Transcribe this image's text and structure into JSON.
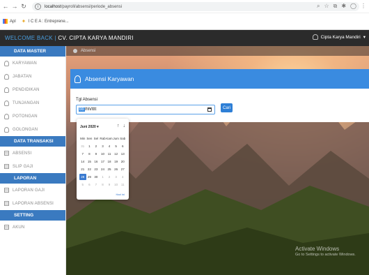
{
  "browser": {
    "url_host": "localhost",
    "url_path": "/payroll/absensi/periode_absensi",
    "bookmarks": [
      {
        "label": "Apl"
      },
      {
        "label": "I C E A : Entreprene..."
      }
    ]
  },
  "topbar": {
    "welcome": "WELCOME BACK |",
    "company": "CV. CIPTA KARYA MANDIRI",
    "user": "Cipta Karya Mandiri",
    "user_caret": "▾"
  },
  "sidebar": {
    "sections": [
      {
        "title": "DATA MASTER",
        "items": [
          "KARYAWAN",
          "JABATAN",
          "PENDIDIKAN",
          "TUNJANGAN",
          "POTONGAN",
          "GOLONGAN"
        ]
      },
      {
        "title": "DATA TRANSAKSI",
        "items": [
          "ABSENSI",
          "SLIP GAJI"
        ]
      },
      {
        "title": "LAPORAN",
        "items": [
          "LAPORAN GAJI",
          "LAPORAN ABSENSI"
        ]
      },
      {
        "title": "SETTING",
        "items": [
          "AKUN"
        ]
      }
    ]
  },
  "breadcrumb": {
    "label": "Absensi"
  },
  "panel": {
    "title": "Absensi Karyawan",
    "field_label": "Tgl Absensi",
    "date_mm": "bb",
    "date_rest": "/hh/tttt",
    "search_button": "Cari"
  },
  "calendar": {
    "month_label": "Juni 2020 ▾",
    "weekdays": [
      "Min",
      "Sen",
      "Sel",
      "Rab",
      "Kam",
      "Jum",
      "Sab"
    ],
    "days": [
      [
        "31",
        "1",
        "2",
        "3",
        "4",
        "5",
        "6"
      ],
      [
        "7",
        "8",
        "9",
        "10",
        "11",
        "12",
        "13"
      ],
      [
        "14",
        "15",
        "16",
        "17",
        "18",
        "19",
        "20"
      ],
      [
        "21",
        "22",
        "23",
        "24",
        "25",
        "26",
        "27"
      ],
      [
        "28",
        "29",
        "30",
        "1",
        "2",
        "3",
        "4"
      ],
      [
        "5",
        "6",
        "7",
        "8",
        "9",
        "10",
        "11"
      ]
    ],
    "today": "28",
    "footer": "Hari ini"
  },
  "watermark": {
    "line1": "Activate Windows",
    "line2": "Go to Settings to activate Windows."
  }
}
